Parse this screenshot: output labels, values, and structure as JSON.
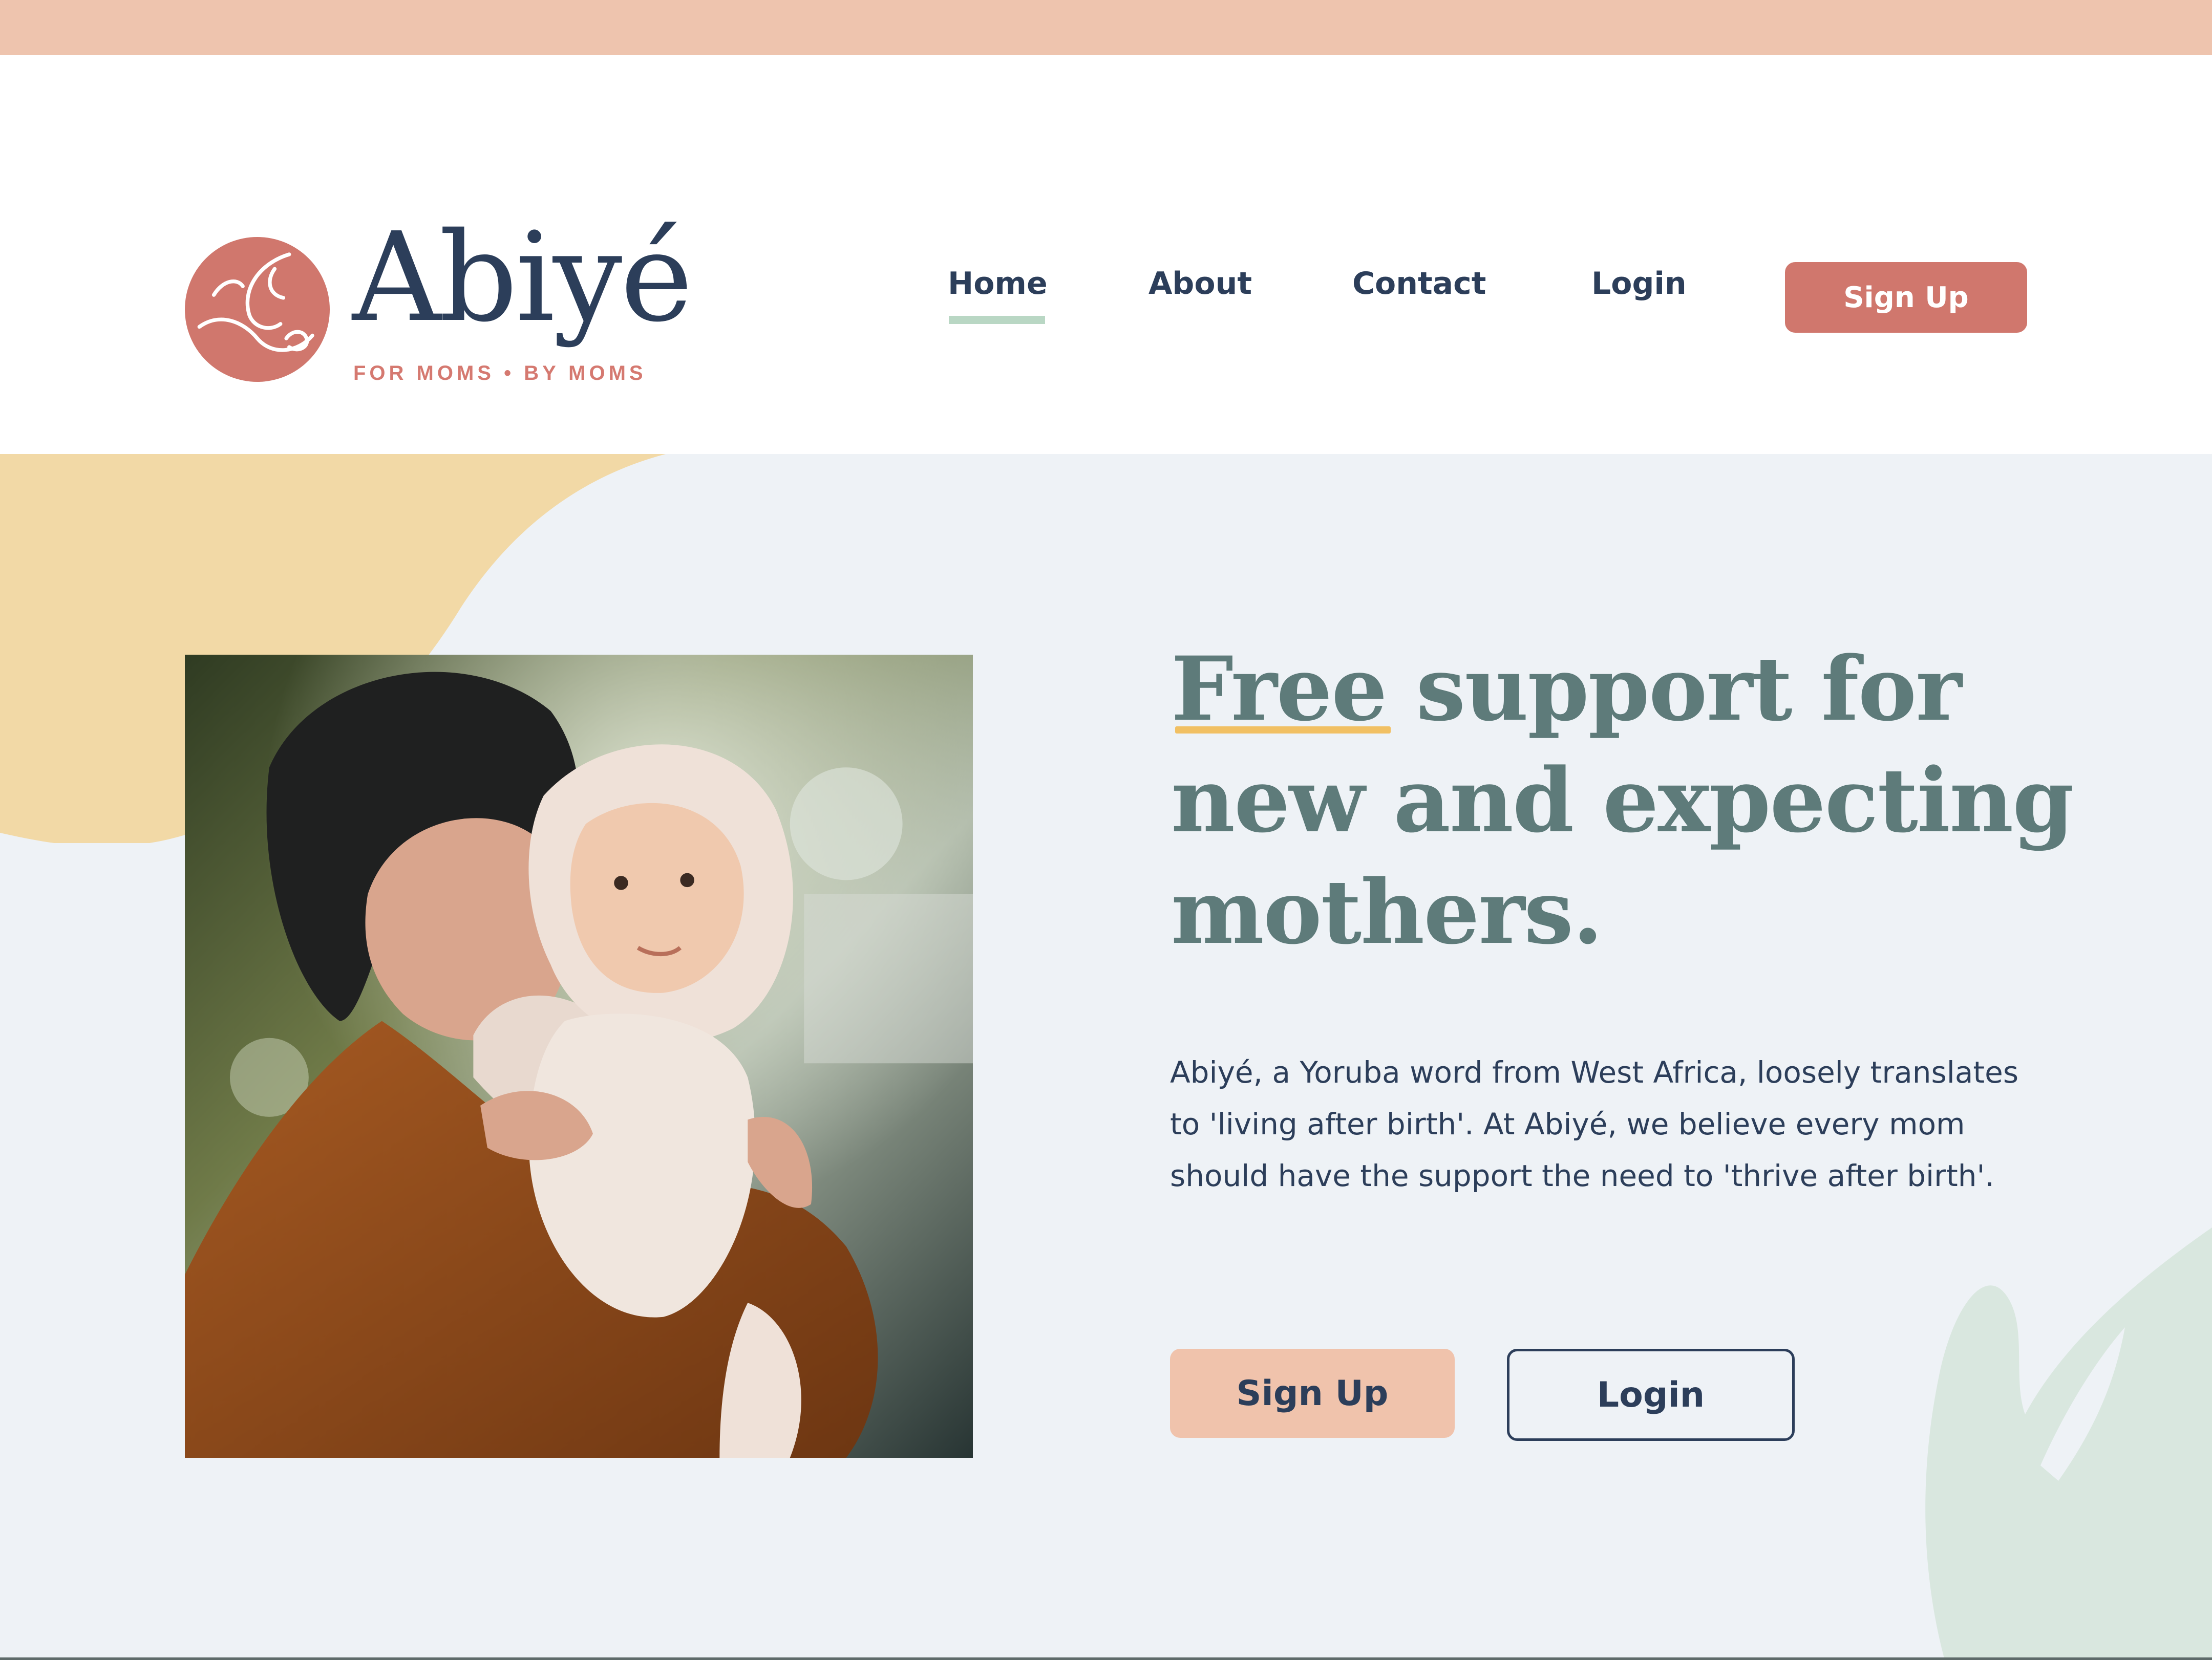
{
  "brand": {
    "name": "Abiyé",
    "tagline": "FOR MOMS • BY MOMS"
  },
  "nav": {
    "items": [
      {
        "label": "Home",
        "active": true
      },
      {
        "label": "About"
      },
      {
        "label": "Contact"
      },
      {
        "label": "Login"
      }
    ],
    "signup_label": "Sign Up"
  },
  "hero": {
    "headline_first_word": "Free",
    "headline_rest": " support for new and expecting mothers.",
    "intro": "Abiyé, a Yoruba word from West Africa, loosely translates to 'living after birth'. At Abiyé, we believe every mom should have the support the need to 'thrive after birth'.",
    "cta_primary": "Sign Up",
    "cta_secondary": "Login"
  },
  "colors": {
    "top_strip": "#eec4ae",
    "brand_coral": "#d0776d",
    "navy_text": "#2c3e5a",
    "headline_teal": "#5e7b7a",
    "hero_background": "#eef2f6",
    "blob_yellow": "#f2d9a6",
    "blob_green": "#d9e7df",
    "active_underline": "#b9d7c4",
    "headline_underline": "#f1c063",
    "cta_peach": "#f0c3ac"
  },
  "icons": {
    "logo": "mother-baby-circle-logo"
  }
}
